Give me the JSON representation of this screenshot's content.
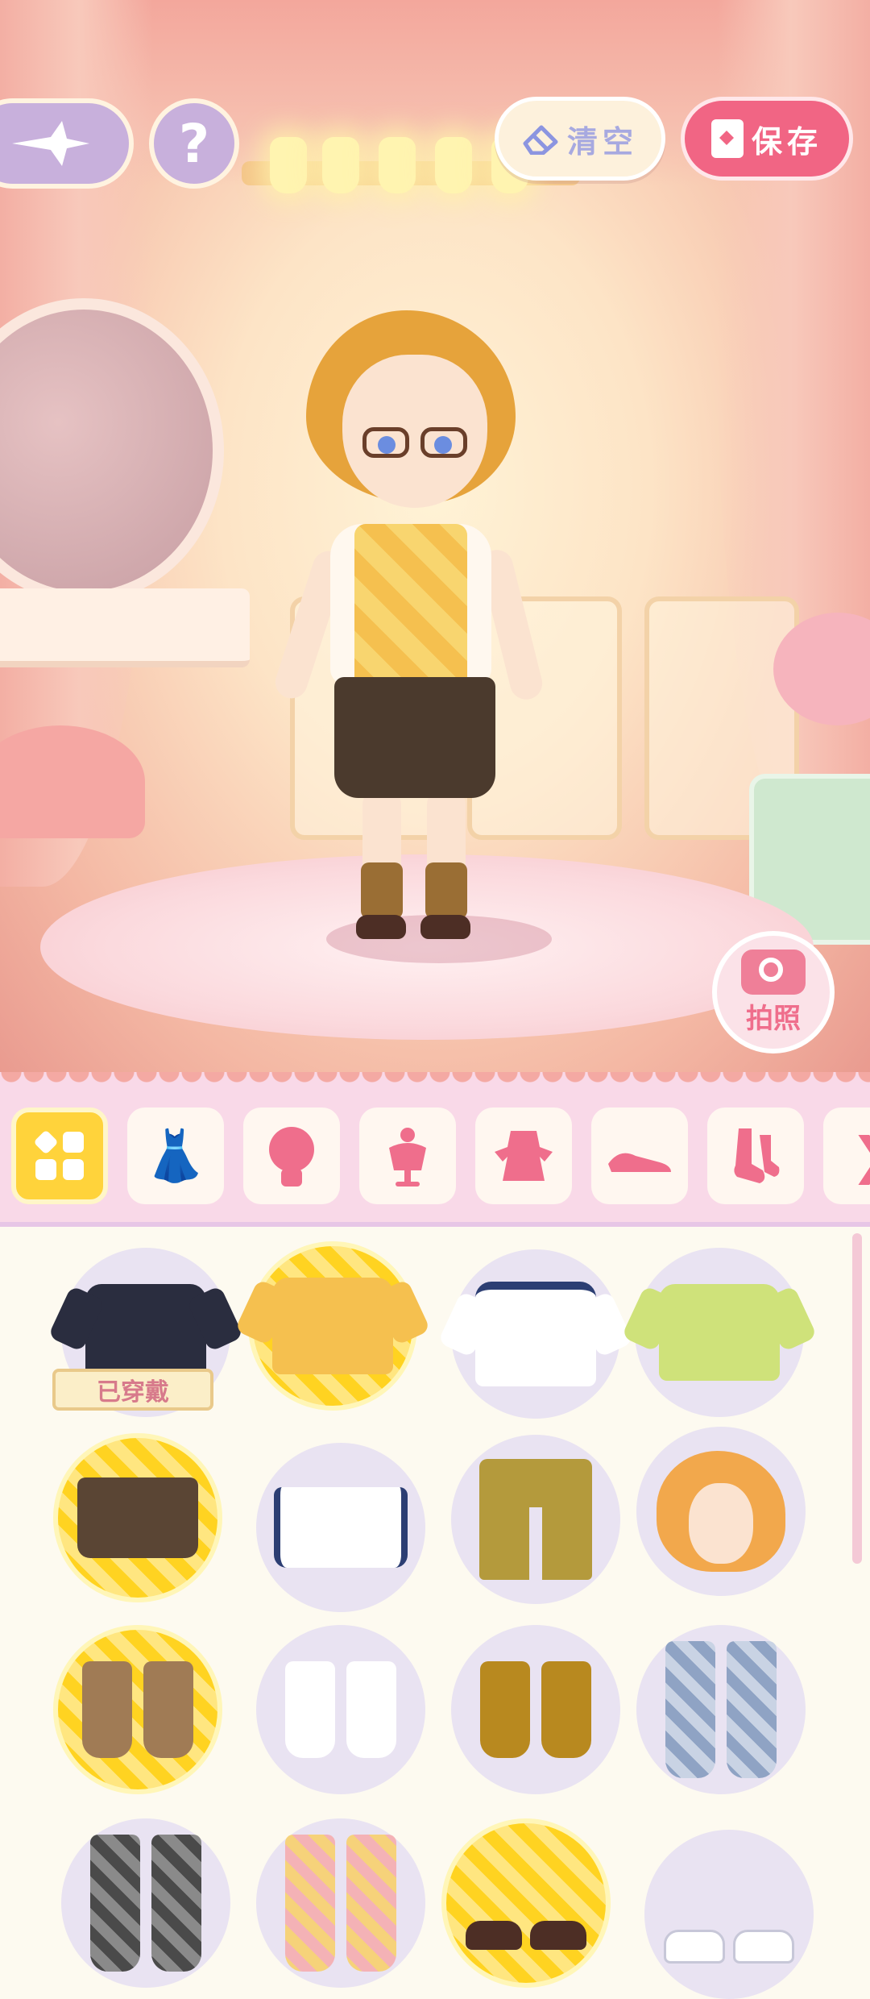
{
  "toolbar": {
    "clear_label": "清空",
    "save_label": "保存",
    "help_label": "?"
  },
  "photo": {
    "label": "拍照"
  },
  "categories": [
    {
      "name": "all",
      "icon": "grid-icon",
      "active": true
    },
    {
      "name": "outfit-set",
      "icon": "outfit-set-icon"
    },
    {
      "name": "hair",
      "icon": "hair-icon"
    },
    {
      "name": "top",
      "icon": "top-icon"
    },
    {
      "name": "dress",
      "icon": "dress-icon"
    },
    {
      "name": "shoes",
      "icon": "shoes-icon"
    },
    {
      "name": "socks",
      "icon": "socks-icon"
    },
    {
      "name": "more",
      "icon": "more-icon"
    }
  ],
  "items": {
    "worn_label": "已穿戴",
    "list": [
      {
        "name": "black-coat",
        "selected": false,
        "worn": true
      },
      {
        "name": "yellow-argyle-vest",
        "selected": true
      },
      {
        "name": "white-tshirt-navy",
        "selected": false
      },
      {
        "name": "green-plaid-vest",
        "selected": false
      },
      {
        "name": "brown-shorts",
        "selected": true
      },
      {
        "name": "white-shorts",
        "selected": false
      },
      {
        "name": "khaki-pants",
        "selected": false
      },
      {
        "name": "orange-hair",
        "selected": false
      },
      {
        "name": "brown-socks",
        "selected": true
      },
      {
        "name": "white-socks",
        "selected": false
      },
      {
        "name": "mustard-socks",
        "selected": false
      },
      {
        "name": "blue-argyle-stockings",
        "selected": false
      },
      {
        "name": "grey-argyle-stockings",
        "selected": false
      },
      {
        "name": "yellow-argyle-stockings",
        "selected": false
      },
      {
        "name": "brown-loafers",
        "selected": true
      },
      {
        "name": "white-shoes",
        "selected": false
      }
    ]
  },
  "colors": {
    "accent_pink": "#f16584",
    "selected_yellow": "#ffd321",
    "lavender": "#c8b0dc"
  }
}
